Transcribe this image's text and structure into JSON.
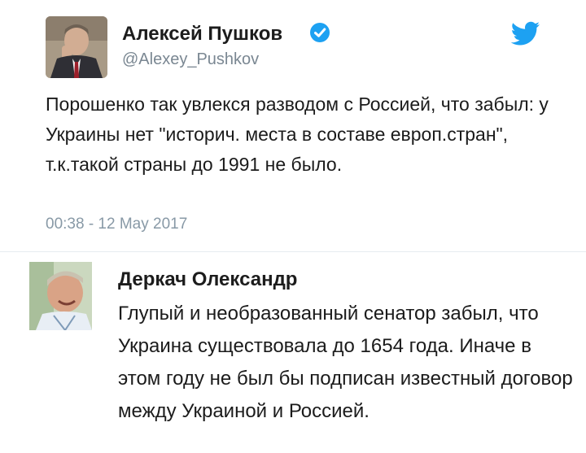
{
  "tweet": {
    "author_name": "Алексей Пушков",
    "handle": "@Alexey_Pushkov",
    "text": "Порошенко так увлекся разводом с Россией, что забыл: у Украины нет \"историч. места в составе европ.стран\", т.к.такой страны до 1991 не было.",
    "timestamp": "00:38 - 12 May 2017",
    "verified_icon": "verified-badge-icon",
    "platform_icon": "twitter-bird-icon",
    "accent_color": "#1da1f2"
  },
  "reply": {
    "author_name": "Деркач Олександр",
    "text": "Глупый и необразованный сенатор забыл, что Украина существовала до 1654 года. Иначе в этом году не был бы подписан известный договор между Украиной и Россией."
  }
}
